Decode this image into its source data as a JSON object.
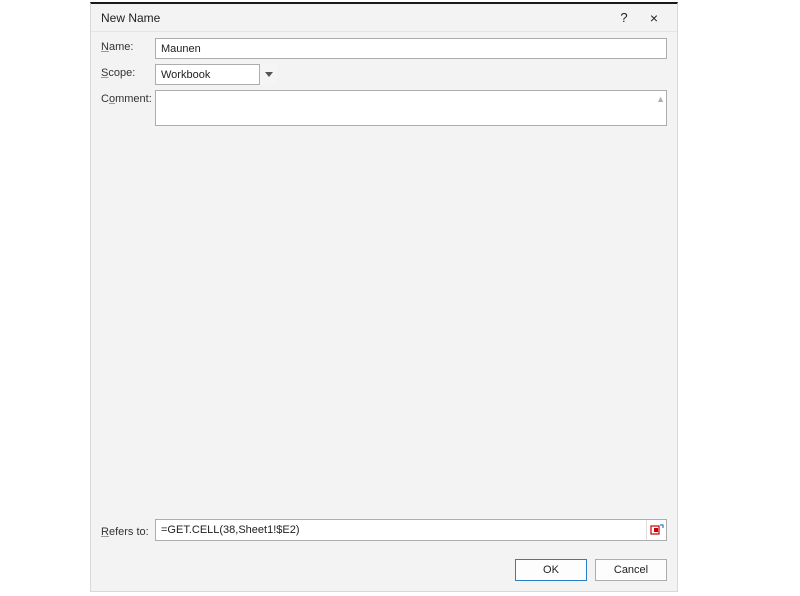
{
  "dialog": {
    "title": "New Name",
    "help_icon": "?",
    "close_icon": "×"
  },
  "fields": {
    "name_label": "Name:",
    "name_value": "Maunen",
    "scope_label": "Scope:",
    "scope_value": "Workbook",
    "comment_label": "Comment:",
    "refersto_label": "Refers to:",
    "refersto_value": "=GET.CELL(38,Sheet1!$E2)"
  },
  "buttons": {
    "ok": "OK",
    "cancel": "Cancel"
  }
}
